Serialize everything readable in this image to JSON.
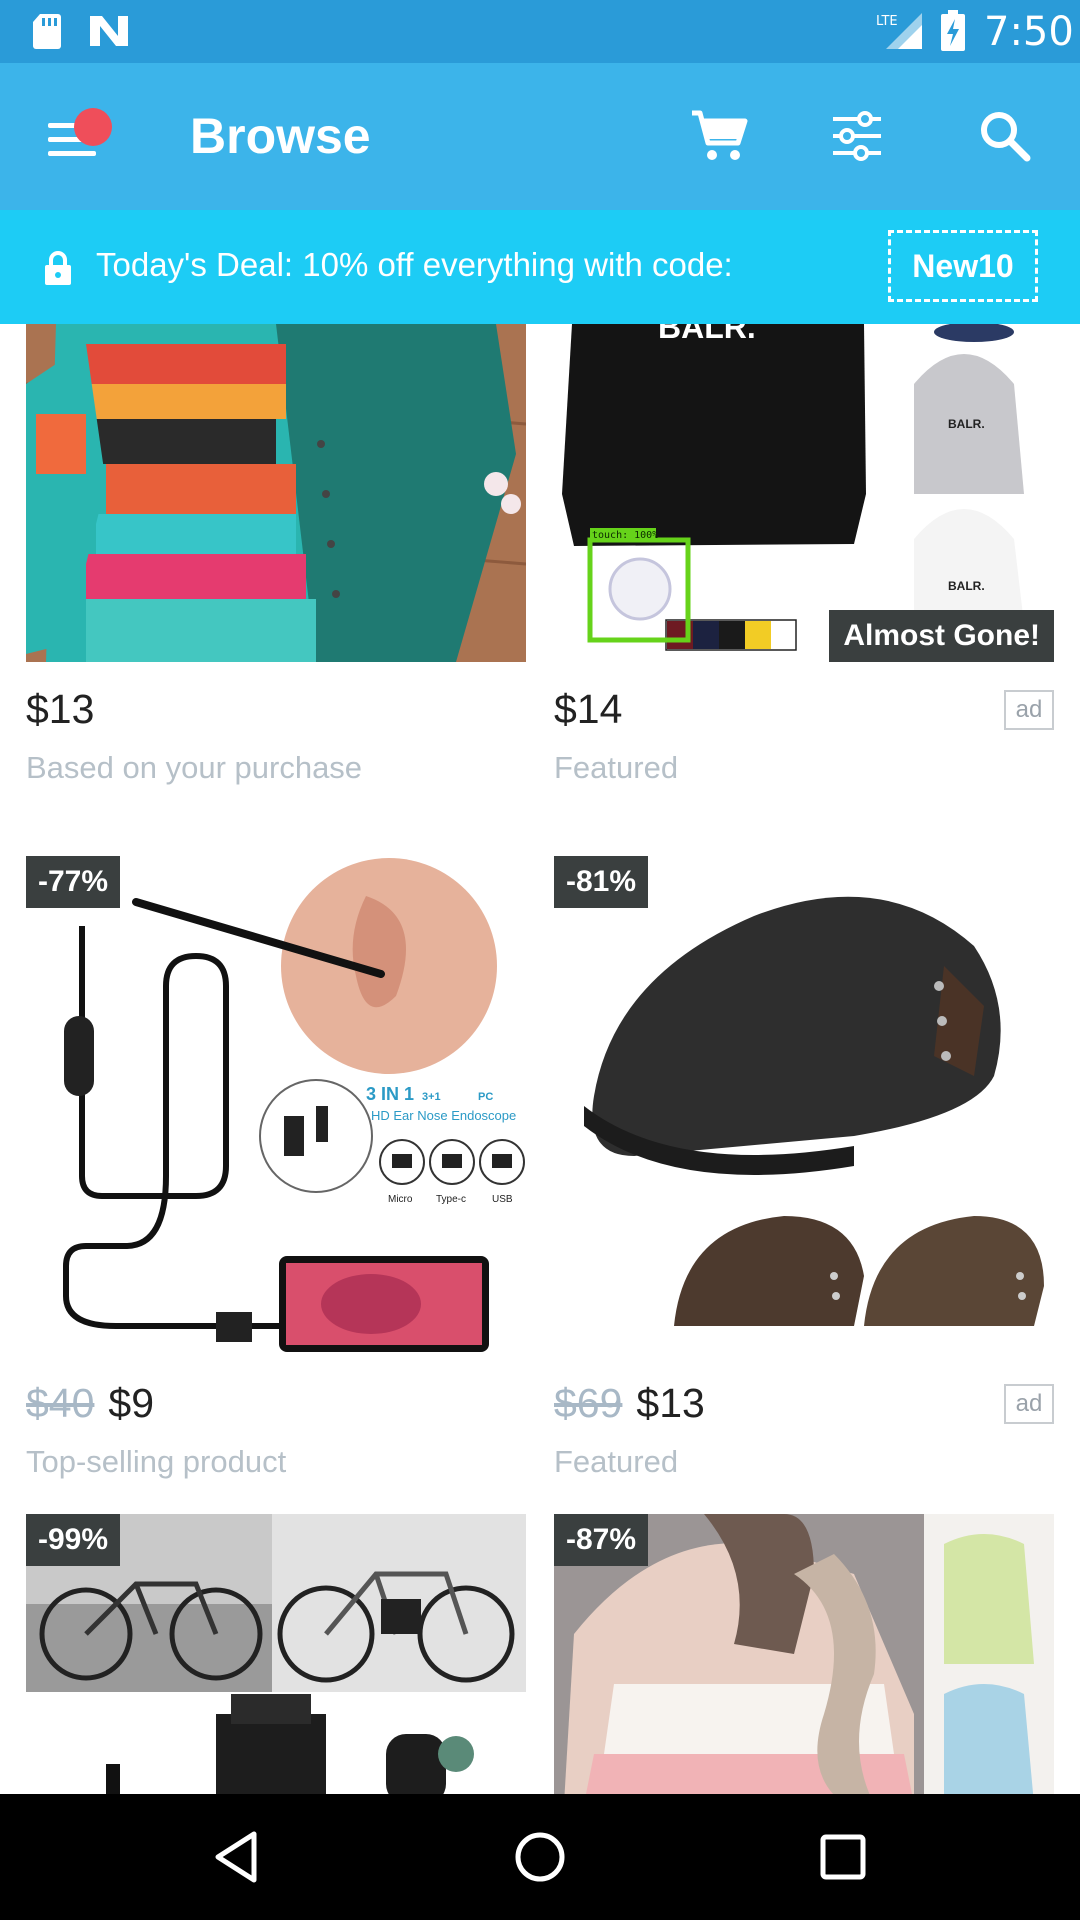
{
  "status_bar": {
    "time": "7:50",
    "network_label": "LTE",
    "icons": [
      "sd-card-icon",
      "n-icon",
      "lte-signal-icon",
      "battery-charging-icon"
    ]
  },
  "app_bar": {
    "title": "Browse",
    "icons": [
      "menu-icon",
      "cart-icon",
      "filter-icon",
      "search-icon"
    ],
    "notification_color": "#ef4e5a",
    "background": "#3cb4ea"
  },
  "deal_banner": {
    "text": "Today's Deal: 10% off everything with code:",
    "code": "New10",
    "background": "#1dccf5"
  },
  "products": [
    {
      "price": "$13",
      "old_price": "",
      "subtitle": "Based on your purchase",
      "discount": "",
      "ad": "",
      "badge": ""
    },
    {
      "price": "$14",
      "old_price": "",
      "subtitle": "Featured",
      "discount": "",
      "ad": "ad",
      "badge": "Almost Gone!"
    },
    {
      "price": "$9",
      "old_price": "$40",
      "subtitle": "Top-selling product",
      "discount": "-77%",
      "ad": "",
      "badge": ""
    },
    {
      "price": "$13",
      "old_price": "$69",
      "subtitle": "Featured",
      "discount": "-81%",
      "ad": "ad",
      "badge": ""
    },
    {
      "price": "",
      "old_price": "",
      "subtitle": "",
      "discount": "-99%",
      "ad": "",
      "badge": ""
    },
    {
      "price": "",
      "old_price": "",
      "subtitle": "",
      "discount": "-87%",
      "ad": "",
      "badge": ""
    }
  ],
  "product_image_text": {
    "hoodie_brand": "BALR.",
    "touch_label": "touch: 100%",
    "endoscope_title": "3 IN 1",
    "endoscope_subtitle": "HD Ear Nose Endoscope",
    "endoscope_ports": [
      "Micro",
      "Type-c",
      "USB"
    ],
    "endoscope_chips": [
      "3+1",
      "PC"
    ]
  },
  "nav_bar": {
    "icons": [
      "back-icon",
      "home-icon",
      "recents-icon"
    ]
  }
}
